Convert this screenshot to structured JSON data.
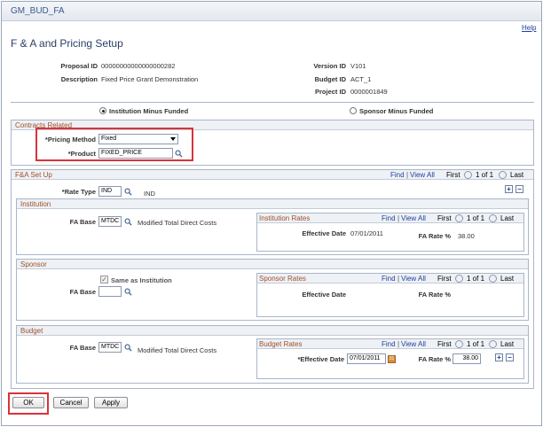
{
  "window": {
    "title": "GM_BUD_FA",
    "help": "Help"
  },
  "page_title": "F & A and Pricing Setup",
  "header": {
    "proposal_id_label": "Proposal ID",
    "proposal_id": "00000000000000000282",
    "description_label": "Description",
    "description": "Fixed Price Grant Demonstration",
    "version_id_label": "Version ID",
    "version_id": "V101",
    "budget_id_label": "Budget ID",
    "budget_id": "ACT_1",
    "project_id_label": "Project ID",
    "project_id": "0000001849"
  },
  "funding": {
    "option1": "Institution Minus Funded",
    "option2": "Sponsor Minus Funded",
    "selected": "Institution Minus Funded"
  },
  "contracts": {
    "title": "Contracts Related",
    "pricing_label": "*Pricing Method",
    "pricing_value": "Fixed",
    "product_label": "*Product",
    "product_value": "FIXED_PRICE"
  },
  "fa_setup": {
    "title": "F&A Set Up",
    "find": "Find",
    "view_all": "View All",
    "first": "First",
    "range": "1 of 1",
    "last": "Last",
    "rate_type_label": "*Rate Type",
    "rate_type_value": "IND",
    "rate_type_desc": "IND"
  },
  "institution": {
    "title": "Institution",
    "fa_base_label": "FA Base",
    "fa_base_value": "MTDC",
    "fa_base_desc": "Modified Total Direct Costs",
    "rates": {
      "title": "Institution Rates",
      "find": "Find",
      "view_all": "View All",
      "first": "First",
      "range": "1 of 1",
      "last": "Last",
      "eff_label": "Effective Date",
      "eff_value": "07/01/2011",
      "rate_label": "FA Rate %",
      "rate_value": "38.00"
    }
  },
  "sponsor": {
    "title": "Sponsor",
    "same_label": "Same as Institution",
    "fa_base_label": "FA Base",
    "fa_base_value": "",
    "rates": {
      "title": "Sponsor Rates",
      "find": "Find",
      "view_all": "View All",
      "first": "First",
      "range": "1 of 1",
      "last": "Last",
      "eff_label": "Effective Date",
      "rate_label": "FA Rate %"
    }
  },
  "budget": {
    "title": "Budget",
    "fa_base_label": "FA Base",
    "fa_base_value": "MTDC",
    "fa_base_desc": "Modified Total Direct Costs",
    "rates": {
      "title": "Budget Rates",
      "find": "Find",
      "view_all": "View All",
      "first": "First",
      "range": "1 of 1",
      "last": "Last",
      "eff_label": "*Effective Date",
      "eff_value": "07/01/2011",
      "rate_label": "FA Rate %",
      "rate_value": "38.00"
    }
  },
  "buttons": {
    "ok": "OK",
    "cancel": "Cancel",
    "apply": "Apply"
  },
  "sep": "|",
  "plus": "+",
  "minus": "−",
  "calendar_glyph": "31",
  "check_glyph": "✓",
  "colors": {
    "accent_red": "#d9333a",
    "section_orange": "#a0502a",
    "link_blue": "#1f3f9f"
  }
}
